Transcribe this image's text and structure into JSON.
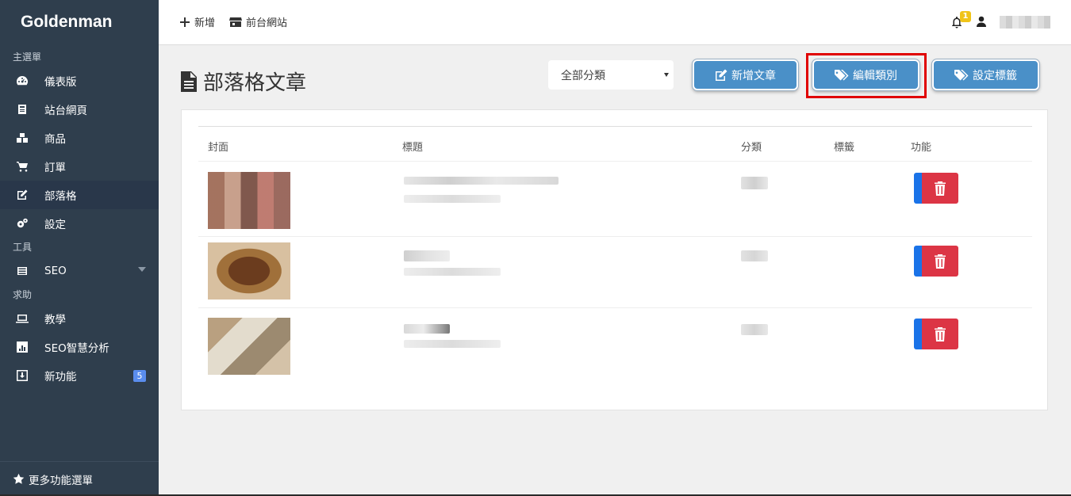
{
  "sidebar": {
    "brand": "Goldenman",
    "sections": [
      {
        "label": "主選單"
      },
      {
        "label": "工具"
      },
      {
        "label": "求助"
      }
    ],
    "items": [
      {
        "label": "儀表版",
        "icon": "dashboard-icon"
      },
      {
        "label": "站台網頁",
        "icon": "page-icon"
      },
      {
        "label": "商品",
        "icon": "boxes-icon"
      },
      {
        "label": "訂單",
        "icon": "cart-icon"
      },
      {
        "label": "部落格",
        "icon": "edit-icon",
        "active": true
      },
      {
        "label": "設定",
        "icon": "gears-icon"
      },
      {
        "label": "SEO",
        "icon": "list-icon"
      },
      {
        "label": "教學",
        "icon": "laptop-icon"
      },
      {
        "label": "SEO智慧分析",
        "icon": "bar-chart-icon"
      },
      {
        "label": "新功能",
        "icon": "download-icon",
        "badge": "5"
      }
    ],
    "footer": "更多功能選單"
  },
  "topbar": {
    "add_label": "新增",
    "frontsite_label": "前台網站",
    "notification_count": "1"
  },
  "page": {
    "title": "部落格文章",
    "category_select": "全部分類",
    "buttons": {
      "new_post": "新增文章",
      "edit_category": "編輯類別",
      "set_tags": "設定標籤"
    },
    "highlight_color": "#e00000"
  },
  "table": {
    "headers": [
      "封面",
      "標題",
      "分類",
      "標籤",
      "功能"
    ],
    "rows": [
      {
        "cover": "blurred-image-1"
      },
      {
        "cover": "blurred-image-2"
      },
      {
        "cover": "blurred-image-3"
      }
    ]
  },
  "colors": {
    "sidebar_bg": "#2f3e4d",
    "button_blue": "#4a90c8",
    "delete_red": "#dc3545",
    "action_blue": "#1a73e8"
  }
}
